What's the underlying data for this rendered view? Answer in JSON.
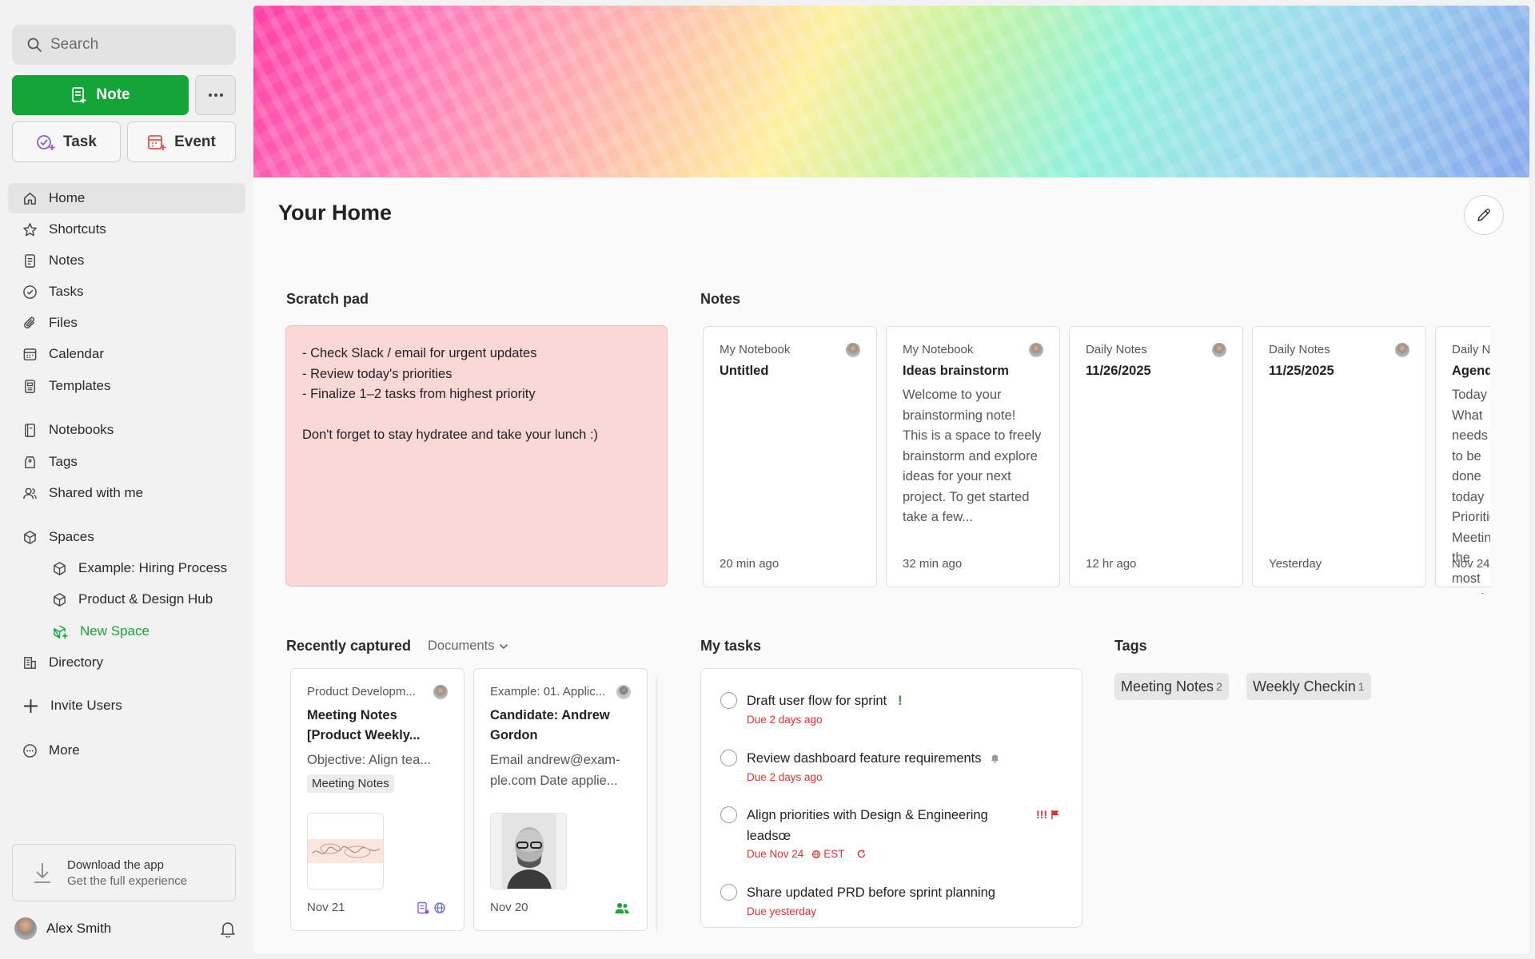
{
  "sidebar": {
    "search_placeholder": "Search",
    "note_button": "Note",
    "task_button": "Task",
    "event_button": "Event",
    "nav": [
      {
        "label": "Home",
        "icon": "home-icon"
      },
      {
        "label": "Shortcuts",
        "icon": "star-icon"
      },
      {
        "label": "Notes",
        "icon": "note-icon"
      },
      {
        "label": "Tasks",
        "icon": "check-circle-icon"
      },
      {
        "label": "Files",
        "icon": "paperclip-icon"
      },
      {
        "label": "Calendar",
        "icon": "calendar-icon"
      },
      {
        "label": "Templates",
        "icon": "template-icon"
      },
      {
        "label": "Notebooks",
        "icon": "notebook-icon"
      },
      {
        "label": "Tags",
        "icon": "tag-icon"
      },
      {
        "label": "Shared with me",
        "icon": "users-icon"
      },
      {
        "label": "Spaces",
        "icon": "cube-icon"
      },
      {
        "label": "Example: Hiring Process",
        "icon": "cube-icon"
      },
      {
        "label": "Product & Design Hub",
        "icon": "cube-icon"
      },
      {
        "label": "New Space",
        "icon": "cube-plus-icon"
      },
      {
        "label": "Directory",
        "icon": "building-icon"
      },
      {
        "label": "Invite Users",
        "icon": "plus-icon"
      },
      {
        "label": "More",
        "icon": "more-circle-icon"
      }
    ],
    "download_title": "Download the app",
    "download_sub": "Get the full experience",
    "user_name": "Alex Smith"
  },
  "main": {
    "title": "Your Home",
    "scratch": {
      "title": "Scratch pad",
      "lines": [
        "- Check Slack / email for urgent updates",
        "- Review today's priorities",
        "- Finalize 1–2 tasks from highest priority",
        "",
        "Don't forget to stay hydratee and take your lunch :)"
      ]
    },
    "notes": {
      "title": "Notes",
      "cards": [
        {
          "notebook": "My Notebook",
          "title": "Untitled",
          "excerpt": "",
          "date": "20 min ago"
        },
        {
          "notebook": "My Notebook",
          "title": "Ideas brainstorm",
          "excerpt": "Welcome to your brainstorming note! This is a space to freely brainstorm and explore ideas for your next project. To get started take a few...",
          "date": "32 min ago"
        },
        {
          "notebook": "Daily Notes",
          "title": "11/26/2025",
          "excerpt": "",
          "date": "12 hr ago"
        },
        {
          "notebook": "Daily Notes",
          "title": "11/25/2025",
          "excerpt": "",
          "date": "Yesterday"
        },
        {
          "notebook": "Daily Notes",
          "title": "Agenda",
          "excerpt": "Today What needs to be done today Priorities Meetings the most meetings",
          "date": "Nov 24"
        }
      ]
    },
    "recent": {
      "title": "Recently captured",
      "filter": "Documents",
      "cards": [
        {
          "notebook": "Product Developm...",
          "title": "Meeting Notes [Product Weekly...",
          "excerpt": "Objective: Align tea...",
          "tag": "Meeting Notes",
          "date": "Nov 21"
        },
        {
          "notebook": "Example: 01. Applic...",
          "title": "Candidate: Andrew Gordon",
          "excerpt": "Email andrew@exam-ple.com Date applie...",
          "date": "Nov 20"
        }
      ]
    },
    "tasks": {
      "title": "My tasks",
      "items": [
        {
          "label": "Draft user flow for sprint",
          "due": "Due 2 days ago"
        },
        {
          "label": "Review dashboard feature requirements",
          "due": "Due 2 days ago"
        },
        {
          "label": "Align priorities with Design & Engineering leadsœ",
          "due": "Due Nov 24",
          "tz": "EST",
          "priority": "!!!"
        },
        {
          "label": "Share updated PRD before sprint planning",
          "due": "Due yesterday"
        }
      ],
      "first_priority": "!"
    },
    "tags": {
      "title": "Tags",
      "items": [
        {
          "label": "Meeting Notes",
          "count": "2"
        },
        {
          "label": "Weekly Checkin",
          "count": "1"
        }
      ]
    }
  },
  "colors": {
    "accent": "#14a539",
    "due_red": "#e0342a",
    "scratch_bg": "#f9d8d6"
  }
}
